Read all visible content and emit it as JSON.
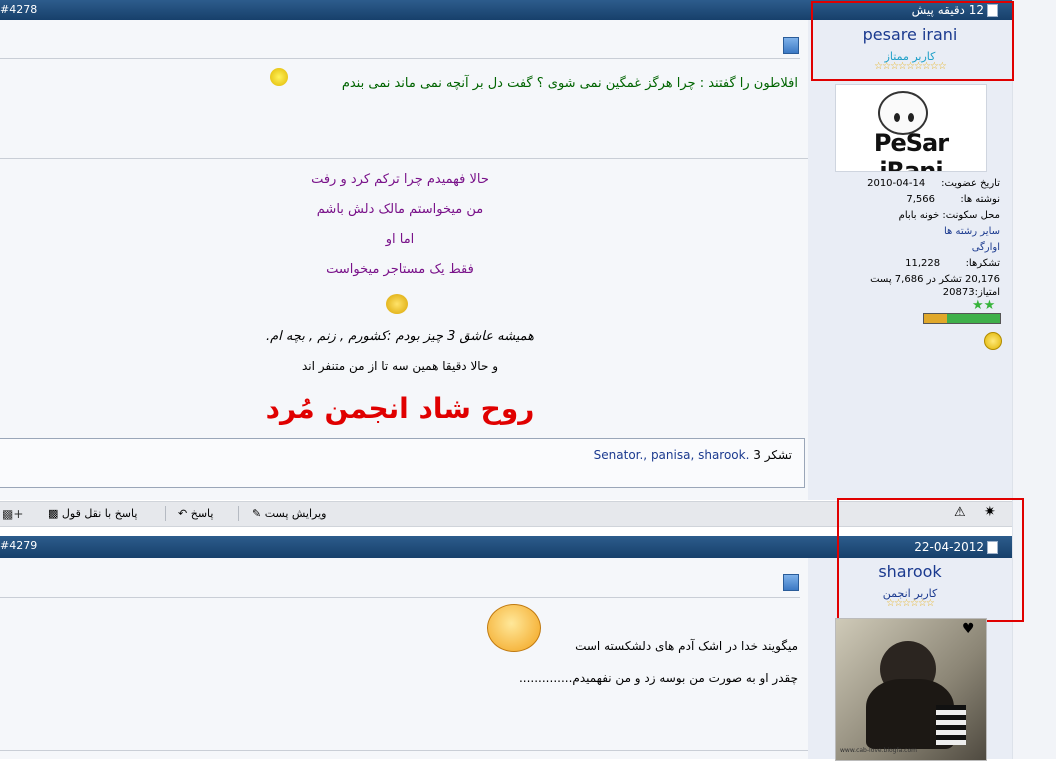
{
  "post1": {
    "number": "#4278",
    "time": "12 دقیقه پیش",
    "username": "pesare irani",
    "user_title": "کاربر ممتاز",
    "stars": "☆☆☆☆☆☆☆☆☆",
    "avatar_text": "PeSar iRani",
    "join_label": "تاریخ عضویت:",
    "join_date": "14-04-2010",
    "posts_label": "نوشته ها:",
    "posts_count": "7,566",
    "location_label": "محل سکونت:",
    "location": "خونه بابام",
    "threads_link": "سایر رشته ها",
    "vagrant": "اوارگی",
    "thanks_label": "تشکرها:",
    "thanks_count": "11,228",
    "thanked_line": "20,176 تشکر در 7,686 پست",
    "points_line": "امتیاز:20873",
    "line1": "افلاطون را گفتند : چرا هرگز غمگین نمی شوی ؟ گفت دل بر آنچه نمی ماند نمی بندم",
    "sig1": "حالا فهمیدم چرا ترکم کرد و رفت",
    "sig2": "من میخواستم مالک دلش باشم",
    "sig3": "اما او",
    "sig4": "فقط یک مستاجر میخواست",
    "sig5": "همیشه عاشق 3 چیز بودم :کشورم , زنم , بچه ام.",
    "sig6": "و حالا دقیقا همین سه تا از من متنفر اند",
    "sig7": "روح شاد انجمن مُرد",
    "thanks_box": "3 تشکر",
    "thanks_names": "Senator., panisa, sharook."
  },
  "toolbar": {
    "edit": "ویرایش پست",
    "reply": "پاسخ",
    "quote_reply": "پاسخ با نقل قول"
  },
  "post2": {
    "number": "#4279",
    "date": "22-04-2012",
    "username": "sharook",
    "user_title": "کاربر انجمن",
    "stars": "☆☆☆☆☆☆",
    "avatar_credit": "www.cab-love.blogfa.com",
    "line1": "میگویند خدا در اشک آدم های دلشکسته است",
    "line2": "چقدر او به صورت من بوسه زد و من نفهمیدم.............."
  },
  "colors": {
    "header_bar": "#17406b",
    "highlight_box": "#e00000",
    "username": "#1b3a8f",
    "signature_purple": "#7a138a",
    "quote_green": "#006400",
    "spirit_red": "#e00000"
  }
}
